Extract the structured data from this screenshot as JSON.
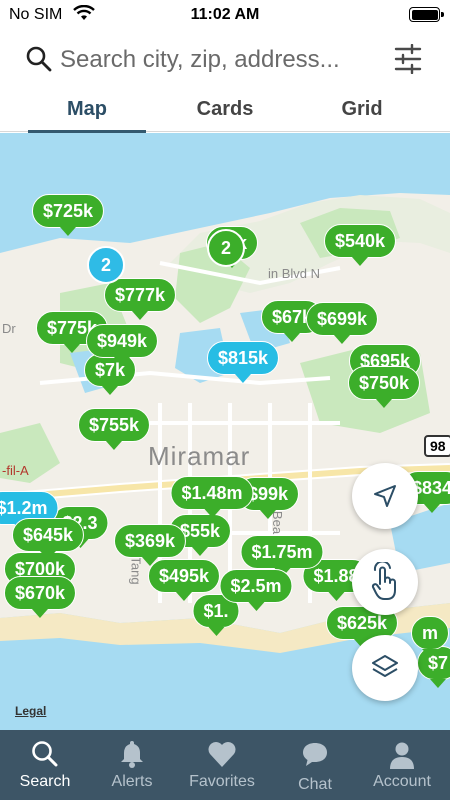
{
  "status_bar": {
    "carrier": "No SIM",
    "time": "11:02 AM"
  },
  "search": {
    "placeholder": "Search city, zip, address..."
  },
  "tabs": [
    {
      "label": "Map",
      "active": true
    },
    {
      "label": "Cards",
      "active": false
    },
    {
      "label": "Grid",
      "active": false
    }
  ],
  "map": {
    "town": "Miramar",
    "roads": [
      "in Blvd N",
      "Dr",
      "-fil-A",
      "Tang",
      "Bea"
    ],
    "shield": "98",
    "legal": "Legal",
    "price_pins": [
      {
        "label": "$725k",
        "color": "green"
      },
      {
        "label": "$777k",
        "color": "green"
      },
      {
        "label": "$775k",
        "color": "green"
      },
      {
        "label": "$949k",
        "color": "green"
      },
      {
        "label": "$7k",
        "color": "green"
      },
      {
        "label": "$815k",
        "color": "blue"
      },
      {
        "label": "$755k",
        "color": "green"
      },
      {
        "label": "$540k",
        "color": "green"
      },
      {
        "label": "$67k",
        "color": "green"
      },
      {
        "label": "$699k",
        "color": "green"
      },
      {
        "label": "$695k",
        "color": "green"
      },
      {
        "label": "$750k",
        "color": "green"
      },
      {
        "label": "$5k",
        "color": "green"
      },
      {
        "label": "$1.2m",
        "color": "blue"
      },
      {
        "label": "$645k",
        "color": "green"
      },
      {
        "label": "$2.3",
        "color": "green"
      },
      {
        "label": "$700k",
        "color": "green"
      },
      {
        "label": "$670k",
        "color": "green"
      },
      {
        "label": "$369k",
        "color": "green"
      },
      {
        "label": "$1.48m",
        "color": "green"
      },
      {
        "label": "$99k",
        "color": "green"
      },
      {
        "label": "$55k",
        "color": "green"
      },
      {
        "label": "$1.75m",
        "color": "green"
      },
      {
        "label": "$495k",
        "color": "green"
      },
      {
        "label": "$2.5m",
        "color": "green"
      },
      {
        "label": "$1.",
        "color": "green"
      },
      {
        "label": "$1.88",
        "color": "green"
      },
      {
        "label": "$625k",
        "color": "green"
      },
      {
        "label": "$834",
        "color": "green"
      },
      {
        "label": "$7",
        "color": "green"
      },
      {
        "label": "m",
        "color": "green"
      }
    ],
    "clusters": [
      {
        "label": "2",
        "color": "blue"
      },
      {
        "label": "2",
        "color": "green"
      }
    ]
  },
  "map_controls": {
    "locate": "location-arrow-icon",
    "gesture": "hand-tap-icon",
    "layers": "layers-icon"
  },
  "bottom_nav": [
    {
      "label": "Search",
      "icon": "search-icon",
      "active": true
    },
    {
      "label": "Alerts",
      "icon": "bell-icon",
      "active": false
    },
    {
      "label": "Favorites",
      "icon": "heart-icon",
      "active": false
    },
    {
      "label": "Chat",
      "icon": "chat-bubble-icon",
      "active": false
    },
    {
      "label": "Account",
      "icon": "person-icon",
      "active": false
    }
  ],
  "colors": {
    "pin_green": "#3cae2a",
    "pin_blue": "#27bde4",
    "nav_bg": "#3d5566",
    "water": "#a6dbf2",
    "land": "#f2efe8",
    "park": "#c9e8bd"
  }
}
